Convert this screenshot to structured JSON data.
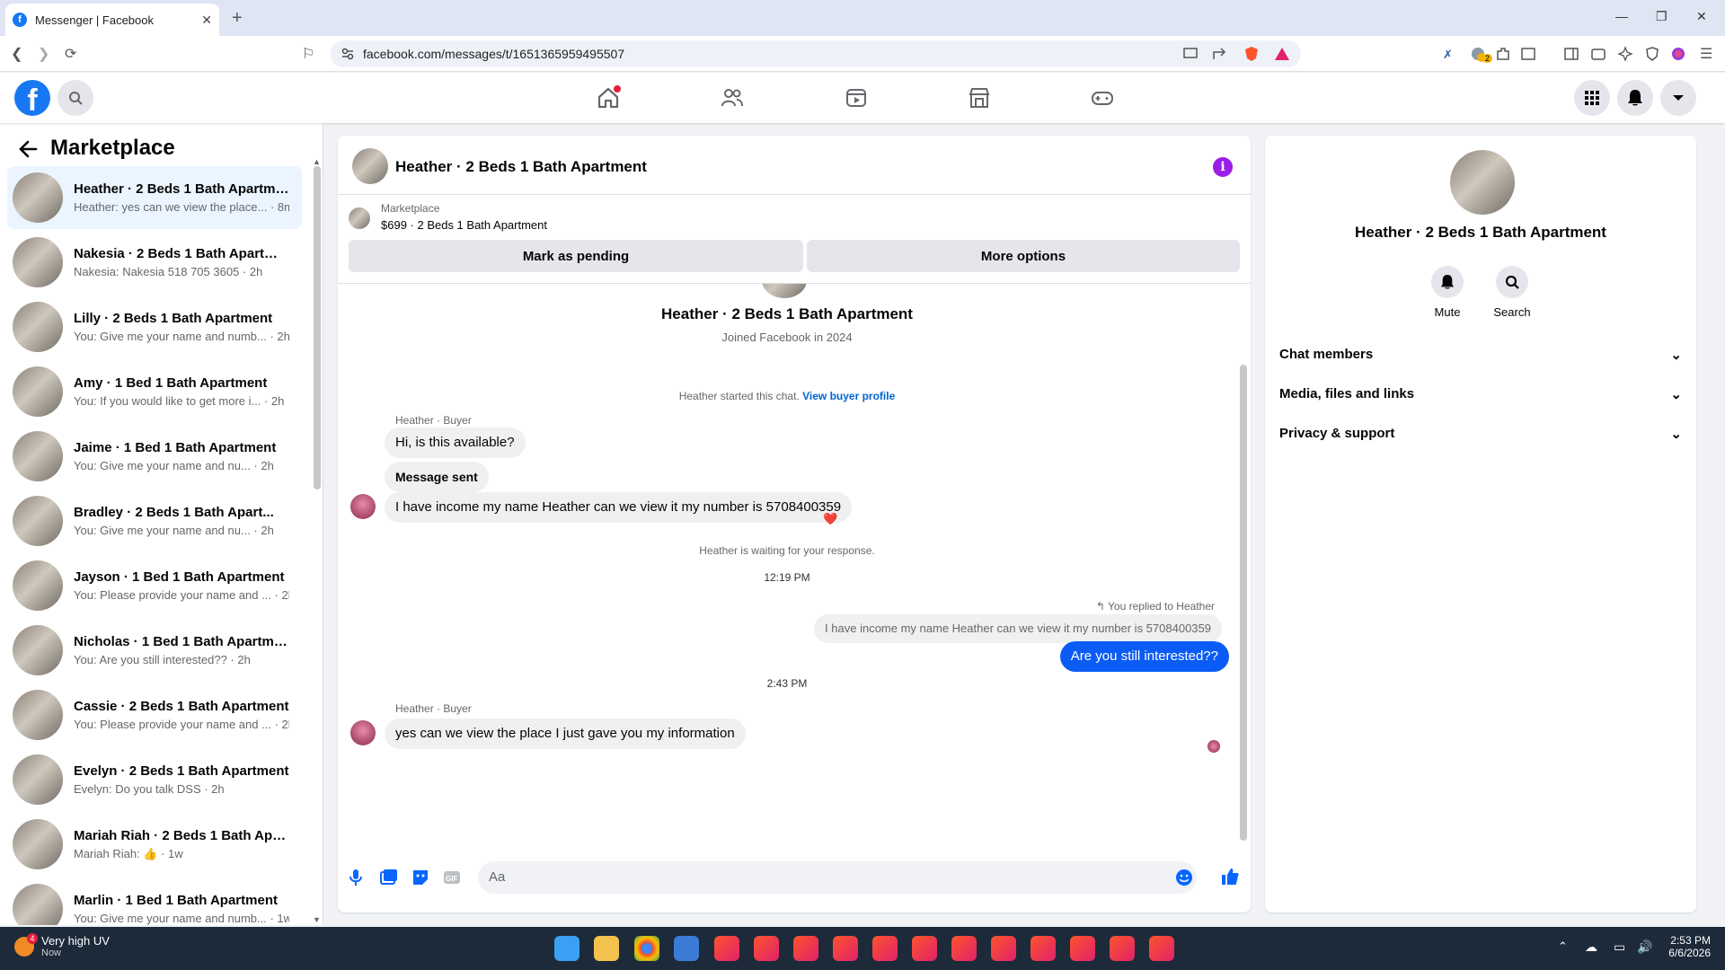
{
  "browser": {
    "tab_title": "Messenger | Facebook",
    "url": "facebook.com/messages/t/1651365959495507",
    "ext_badge": "2"
  },
  "fb": {
    "logo": "f",
    "notif_dot": true
  },
  "sidebar": {
    "title": "Marketplace",
    "conversations": [
      {
        "name": "Heather · 2 Beds 1 Bath Apartme...",
        "preview": "Heather: yes can we view the place... · 8m",
        "active": true
      },
      {
        "name": "Nakesia · 2 Beds 1 Bath Apartme...",
        "preview": "Nakesia: Nakesia 518 705 3605 · 2h"
      },
      {
        "name": "Lilly · 2 Beds 1 Bath Apartment",
        "preview": "You: Give me your name and numb... · 2h"
      },
      {
        "name": "Amy · 1 Bed 1 Bath Apartment",
        "preview": "You: If you would like to get more i... · 2h"
      },
      {
        "name": "Jaime · 1 Bed 1 Bath Apartment",
        "preview": "You: Give me your name and nu... · 2h"
      },
      {
        "name": "Bradley · 2 Beds 1 Bath Apart...",
        "preview": "You: Give me your name and nu... · 2h"
      },
      {
        "name": "Jayson · 1 Bed 1 Bath Apartment",
        "preview": "You: Please provide your name and ... · 2h"
      },
      {
        "name": "Nicholas · 1 Bed 1 Bath Apartment",
        "preview": "You: Are you still interested?? · 2h"
      },
      {
        "name": "Cassie · 2 Beds 1 Bath Apartment",
        "preview": "You: Please provide your name and ... · 2h"
      },
      {
        "name": "Evelyn · 2 Beds 1 Bath Apartment",
        "preview": "Evelyn: Do you talk DSS · 2h"
      },
      {
        "name": "Mariah Riah · 2 Beds 1 Bath Apar...",
        "preview": "Mariah Riah: 👍 · 1w"
      },
      {
        "name": "Marlin · 1 Bed 1 Bath Apartment",
        "preview": "You: Give me your name and numb... · 1w"
      }
    ]
  },
  "chat": {
    "title": "Heather · 2 Beds 1 Bath Apartment",
    "listing_source": "Marketplace",
    "listing_price": "$699 · 2 Beds 1 Bath Apartment",
    "mark_pending": "Mark as pending",
    "more_options": "More options",
    "profile_name": "Heather · 2 Beds 1 Bath Apartment",
    "joined": "Joined Facebook in 2024",
    "started": "Heather started this chat.",
    "view_profile": "View buyer profile",
    "sender1": "Heather · Buyer",
    "msg1": "Hi, is this available?",
    "msg2": "Message sent",
    "msg3": "I have income my name Heather can we view it my number is 5708400359",
    "reaction": "❤️",
    "waiting": "Heather is waiting for your response.",
    "time1": "12:19 PM",
    "replied": "You replied to Heather",
    "quoted": "I have income my name Heather can we view it my number is 5708400359",
    "my_msg": "Are you still interested??",
    "time2": "2:43 PM",
    "sender2": "Heather · Buyer",
    "msg4": "yes can we view the place I just gave you my information",
    "input_placeholder": "Aa"
  },
  "details": {
    "name": "Heather · 2 Beds 1 Bath Apartment",
    "mute": "Mute",
    "search": "Search",
    "sections": [
      "Chat members",
      "Media, files and links",
      "Privacy & support"
    ]
  },
  "taskbar": {
    "weather_title": "Very high UV",
    "weather_sub": "Now",
    "weather_badge": "4",
    "time": "2:53 PM",
    "date": "6/6/2026"
  },
  "colors": {
    "fb_blue": "#1877f2",
    "my_bubble": "#0a5cf5",
    "info": "#9b1de6"
  }
}
